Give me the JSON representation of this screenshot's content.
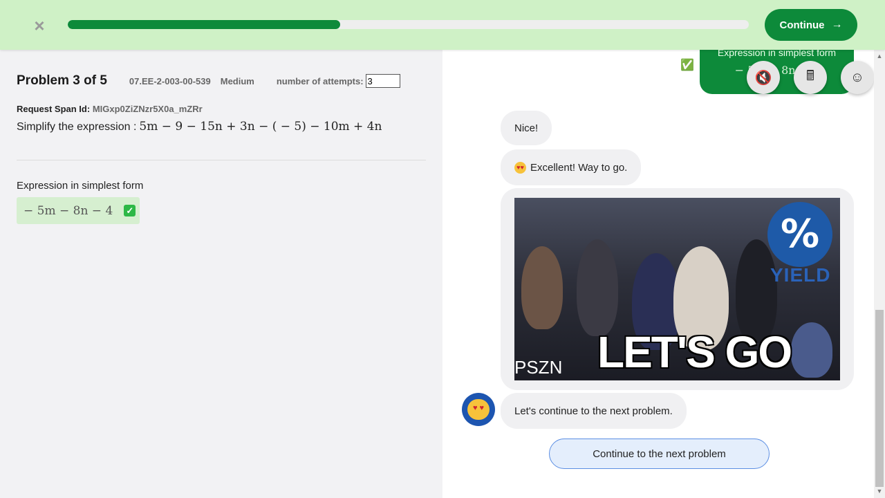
{
  "header": {
    "close_icon": "×",
    "progress_fraction": 0.4,
    "continue_label": "Continue",
    "continue_arrow": "→"
  },
  "problem": {
    "title": "Problem 3 of 5",
    "code": "07.EE-2-003-00-539",
    "difficulty": "Medium",
    "attempts_label": "number of attempts:",
    "attempts_value": "3",
    "span_label": "Request Span Id:",
    "span_value": "MIGxp0ZiZNzr5X0a_mZRr",
    "prompt": "Simplify the expression :",
    "expression": "5m − 9 − 15n + 3n − ( − 5) − 10m + 4n",
    "answer_label": "Expression in simplest form",
    "answer_value": "− 5m − 8n − 4",
    "answer_status_icon": "✓"
  },
  "chat": {
    "user_bubble_label": "Expression in simplest form",
    "user_bubble_math": "− 5m − 8n − 4",
    "user_check_icon": "✅",
    "tools": [
      {
        "name": "mute-icon",
        "glyph": "🔇"
      },
      {
        "name": "calculator-icon",
        "glyph": "🖩"
      },
      {
        "name": "brain-icon",
        "glyph": "☺"
      }
    ],
    "messages": [
      "Nice!",
      "Excellent! Way to go.",
      "Let's continue to the next problem."
    ],
    "gif_caption": "LET'S GO",
    "gif_logo_symbol": "%",
    "gif_logo_word": "YIELD",
    "gif_corner_text": "PSZN",
    "next_problem_label": "Continue to the next problem"
  },
  "scrollbar": {
    "up": "▲",
    "down": "▼"
  }
}
